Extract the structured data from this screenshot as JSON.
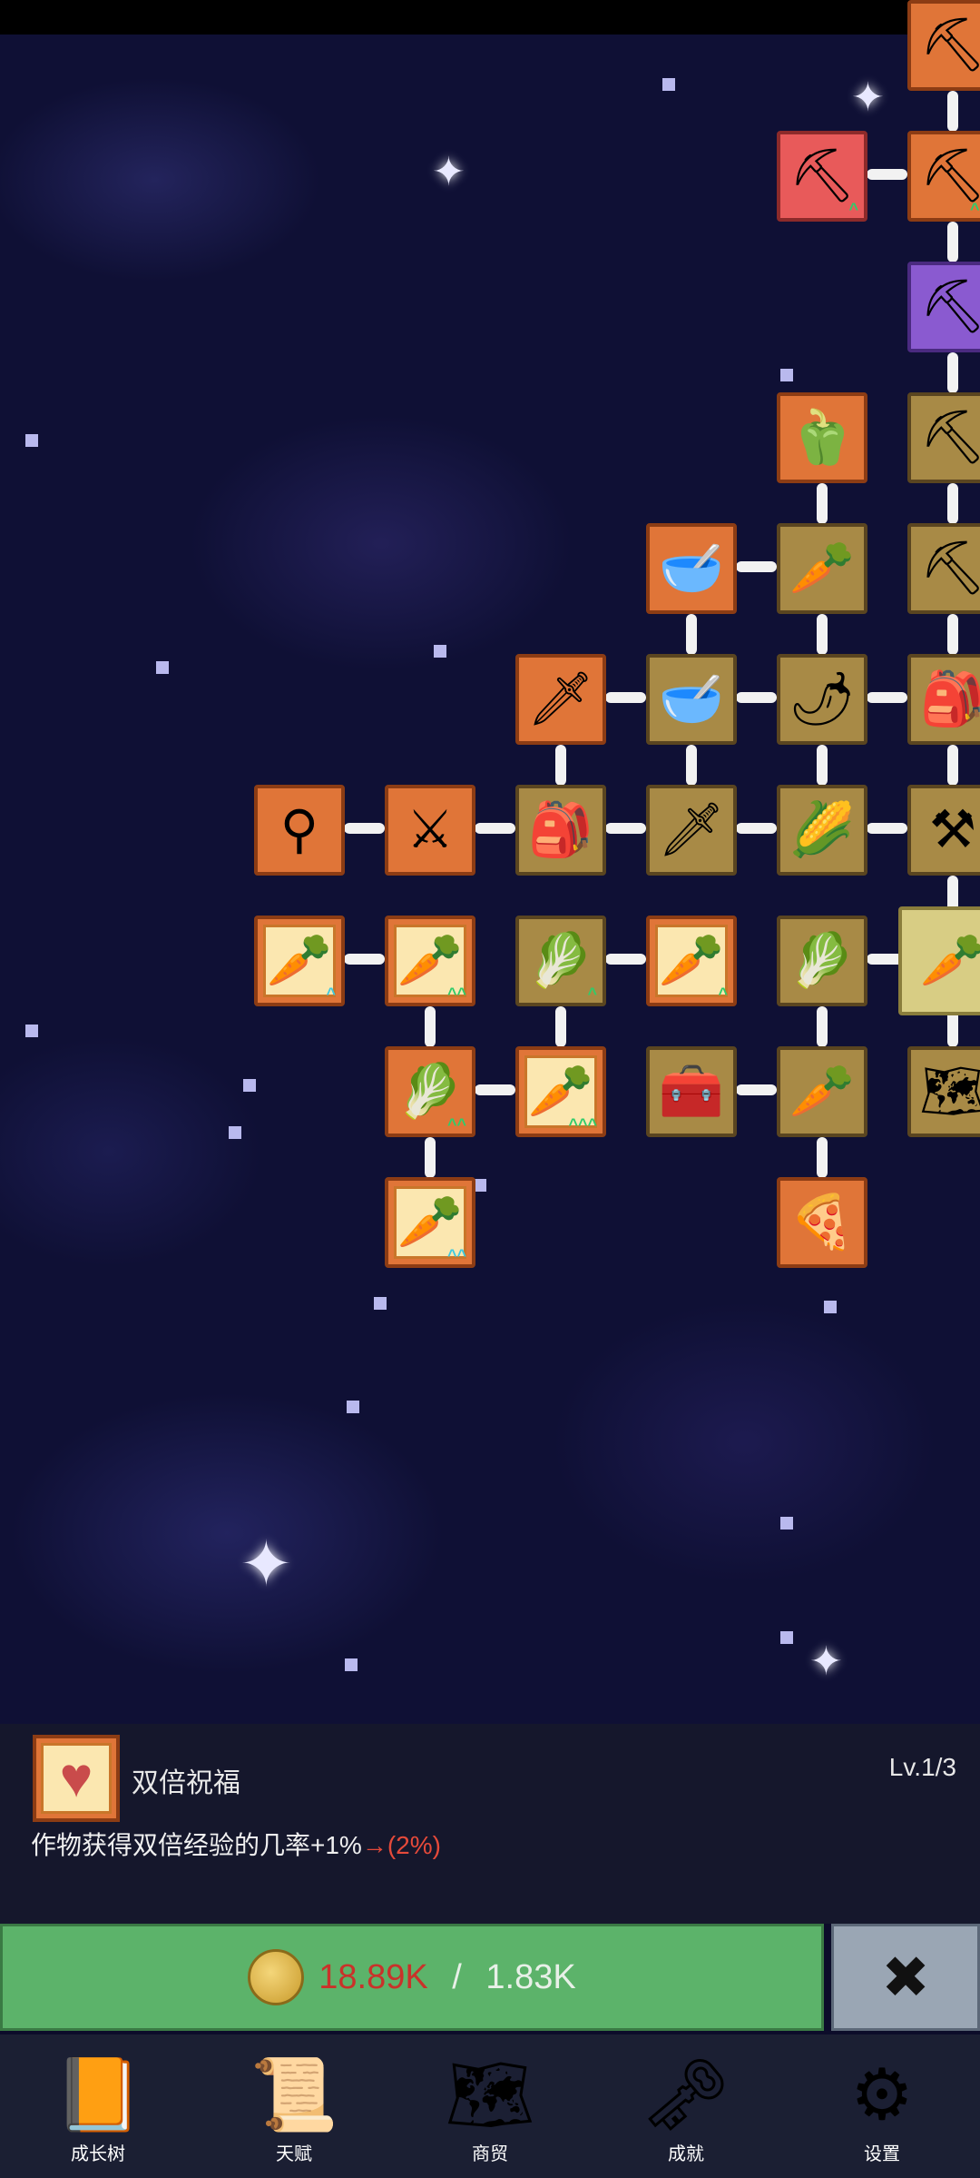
{
  "skill_tree": {
    "nodes": [
      {
        "name": "shovel-node",
        "glyph": "⛏"
      },
      {
        "name": "shovel-node",
        "glyph": "⛏"
      },
      {
        "name": "shovel-node",
        "glyph": "⛏"
      },
      {
        "name": "shovel-node",
        "glyph": "⛏"
      },
      {
        "name": "shovel-node",
        "glyph": "⛏"
      },
      {
        "name": "shovel-node",
        "glyph": "⛏"
      },
      {
        "name": "pepper-node",
        "glyph": "🫑"
      },
      {
        "name": "bowl-node",
        "glyph": "🥣"
      },
      {
        "name": "radish-node",
        "glyph": "🥕"
      },
      {
        "name": "sword-node",
        "glyph": "🗡"
      },
      {
        "name": "bowl-node",
        "glyph": "🥣"
      },
      {
        "name": "chili-node",
        "glyph": "🌶"
      },
      {
        "name": "backpack-node",
        "glyph": "🎒"
      },
      {
        "name": "staff-node",
        "glyph": "⚲"
      },
      {
        "name": "sword-node",
        "glyph": "⚔"
      },
      {
        "name": "backpack-node",
        "glyph": "🎒"
      },
      {
        "name": "sword-node",
        "glyph": "🗡"
      },
      {
        "name": "corn-node",
        "glyph": "🌽"
      },
      {
        "name": "scythe-node",
        "glyph": "⚒"
      },
      {
        "name": "carrot-node",
        "glyph": "🥕"
      },
      {
        "name": "carrot-node",
        "glyph": "🥕"
      },
      {
        "name": "cabbage-node",
        "glyph": "🥬"
      },
      {
        "name": "carrot-node",
        "glyph": "🥕"
      },
      {
        "name": "cabbage-node",
        "glyph": "🥬"
      },
      {
        "name": "carrot-node",
        "glyph": "🥕"
      },
      {
        "name": "cabbage-node",
        "glyph": "🥬"
      },
      {
        "name": "carrot-node",
        "glyph": "🥕"
      },
      {
        "name": "chest-node",
        "glyph": "🧰"
      },
      {
        "name": "parsnip-node",
        "glyph": "🥕"
      },
      {
        "name": "map-node",
        "glyph": "🗺"
      },
      {
        "name": "carrot-node",
        "glyph": "🥕"
      },
      {
        "name": "pizza-node",
        "glyph": "🍕"
      }
    ]
  },
  "selected_skill": {
    "icon": "heart-icon",
    "name": "双倍祝福",
    "level": "Lv.1/3",
    "description": "作物获得双倍经验的几率+1%",
    "next_value": "→(2%)"
  },
  "upgrade": {
    "current": "18.89K",
    "separator": " / ",
    "cost": "1.83K"
  },
  "close_label": "✖",
  "nav": {
    "items": [
      {
        "label": "成长树",
        "icon": "book-icon",
        "glyph": "📙"
      },
      {
        "label": "天赋",
        "icon": "scroll-icon",
        "glyph": "📜"
      },
      {
        "label": "商贸",
        "icon": "map-icon",
        "glyph": "🗺"
      },
      {
        "label": "成就",
        "icon": "key-icon",
        "glyph": "🗝"
      },
      {
        "label": "设置",
        "icon": "gear-icon",
        "glyph": "⚙"
      }
    ]
  },
  "colors": {
    "buy_bg": "#5cb36a",
    "cost_red": "#c9322a",
    "node_orange": "#e07538",
    "node_tan": "#a88a46"
  }
}
